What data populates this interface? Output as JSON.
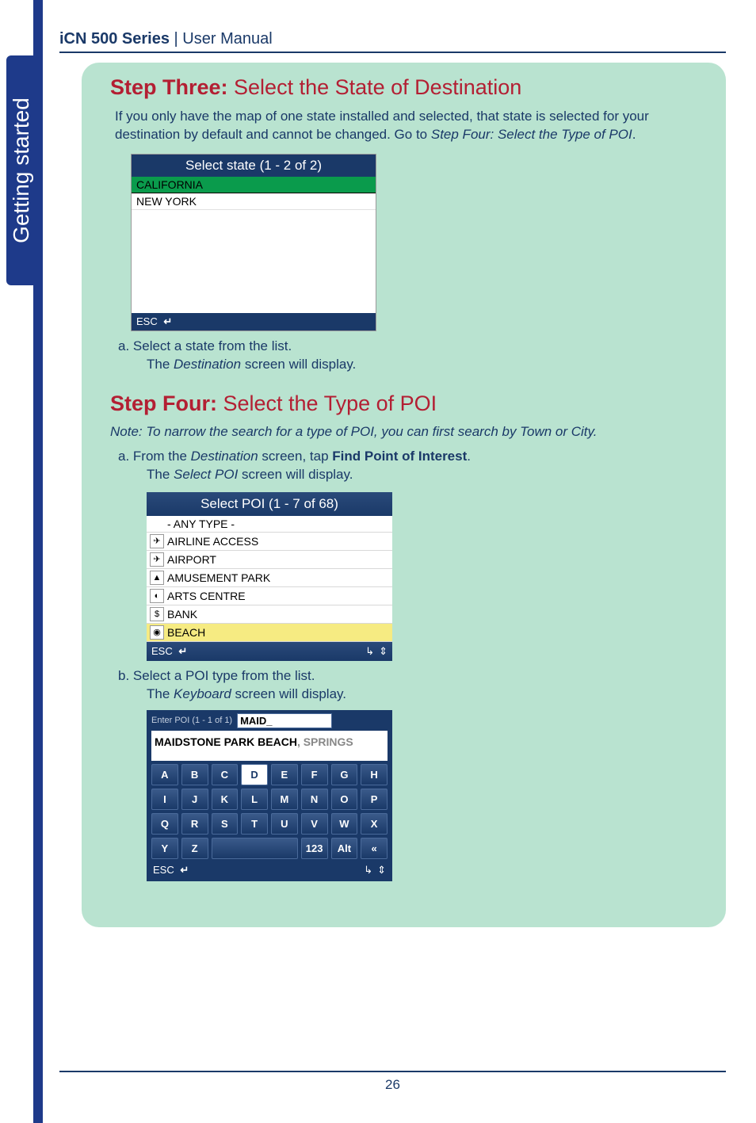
{
  "sidebar": {
    "tab": "Getting started"
  },
  "header": {
    "product": "iCN 500 Series",
    "sep": " | ",
    "doc": "User Manual"
  },
  "step3": {
    "label": "Step Three:",
    "title": " Select the State of Destination",
    "intro1": "If you only have the map of one state installed and selected, that state is selected for your destination by default and cannot be changed. Go to ",
    "intro_em": "Step Four: Select the Type of POI",
    "intro_end": ".",
    "sub_a": "a. Select a state from the list.",
    "sub_a2_pre": "The ",
    "sub_a2_em": "Destination",
    "sub_a2_post": " screen will display."
  },
  "screen1": {
    "title": "Select state (1 - 2 of 2)",
    "items": [
      "CALIFORNIA",
      "NEW YORK"
    ],
    "esc": "ESC"
  },
  "step4": {
    "label": "Step Four:",
    "title": " Select the Type of POI",
    "note": "Note: To narrow the search for a type of POI, you can first search by Town or City.",
    "sub_a_pre": "a. From the ",
    "sub_a_em": "Destination",
    "sub_a_mid": " screen, tap ",
    "sub_a_bold": "Find Point of Interest",
    "sub_a_end": ".",
    "sub_a2_pre": "The ",
    "sub_a2_em": "Select POI",
    "sub_a2_post": " screen will display.",
    "sub_b": "b. Select a POI type from the list.",
    "sub_b2_pre": "The ",
    "sub_b2_em": "Keyboard",
    "sub_b2_post": " screen will display."
  },
  "screen2": {
    "title": "Select POI (1 - 7 of 68)",
    "items": [
      {
        "icon": "",
        "label": "- ANY TYPE -",
        "sel": false
      },
      {
        "icon": "✈",
        "label": "AIRLINE ACCESS",
        "sel": false
      },
      {
        "icon": "✈",
        "label": "AIRPORT",
        "sel": false
      },
      {
        "icon": "▲",
        "label": "AMUSEMENT PARK",
        "sel": false
      },
      {
        "icon": "◐",
        "label": "ARTS CENTRE",
        "sel": false
      },
      {
        "icon": "$",
        "label": "BANK",
        "sel": false
      },
      {
        "icon": "◉",
        "label": "BEACH",
        "sel": true
      }
    ],
    "esc": "ESC"
  },
  "kb": {
    "top_label": "Enter POI (1 - 1 of 1)",
    "input": "MAID_",
    "result_bold": "MAIDSTONE PARK BEACH",
    "result_grey": ", SPRINGS",
    "rows": [
      [
        "A",
        "B",
        "C",
        "D*",
        "E",
        "F",
        "G",
        "H"
      ],
      [
        "I",
        "J",
        "K",
        "L",
        "M",
        "N",
        "O",
        "P"
      ],
      [
        "Q",
        "R",
        "S",
        "T",
        "U",
        "V",
        "W",
        "X"
      ],
      [
        "Y",
        "Z",
        "SPACE",
        "123",
        "Alt",
        "«"
      ]
    ],
    "esc": "ESC"
  },
  "page": "26"
}
